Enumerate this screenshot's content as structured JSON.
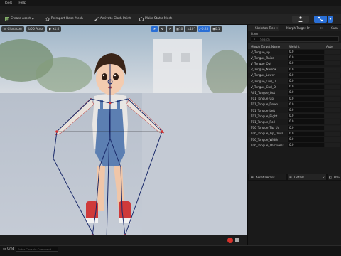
{
  "menubar": {
    "items": [
      "Tools",
      "Help"
    ]
  },
  "toolbar": {
    "buttons": [
      {
        "label": "Create Asset",
        "icon": "create-asset-icon",
        "has_dropdown": true
      },
      {
        "label": "Reimport Base Mesh",
        "icon": "reimport-icon"
      },
      {
        "label": "Activate Cloth Paint",
        "icon": "brush-icon"
      },
      {
        "label": "Make Static Mesh",
        "icon": "static-mesh-icon"
      }
    ]
  },
  "viewport": {
    "chips": [
      {
        "label": "Character",
        "icon": "menu-icon"
      },
      {
        "label": "LOD Auto"
      },
      {
        "label": "x1.0",
        "icon": "play-icon"
      }
    ],
    "tool_values": [
      "10",
      "10°",
      "0.25",
      "4",
      "0.1"
    ],
    "accent": "#2a6fd6"
  },
  "panel": {
    "tabs": [
      {
        "label": "Skeleton Tree",
        "active": true
      },
      {
        "label": "Morph Target Pr",
        "active": false
      },
      {
        "label": "Cura",
        "active": false
      }
    ],
    "items_label": "Item",
    "search_placeholder": "Search",
    "columns": {
      "name": "Morph Target Name",
      "weight": "Weight",
      "auto": "Auto"
    },
    "rows": [
      {
        "name": "V_Tongue_up",
        "weight": "0.0"
      },
      {
        "name": "V_Tongue_Raise",
        "weight": "0.0"
      },
      {
        "name": "V_Tongue_Out",
        "weight": "0.0"
      },
      {
        "name": "V_Tongue_Narrow",
        "weight": "0.0"
      },
      {
        "name": "V_Tongue_Lower",
        "weight": "0.0"
      },
      {
        "name": "V_Tongue_Curl_U",
        "weight": "0.0"
      },
      {
        "name": "V_Tongue_Curl_D",
        "weight": "0.0"
      },
      {
        "name": "A01_Tongue_Out",
        "weight": "0.0"
      },
      {
        "name": "T01_Tongue_Up",
        "weight": "0.0"
      },
      {
        "name": "T01_Tongue_Down",
        "weight": "0.0"
      },
      {
        "name": "T01_Tongue_Left",
        "weight": "0.0"
      },
      {
        "name": "T01_Tongue_Right",
        "weight": "0.0"
      },
      {
        "name": "T01_Tongue_Roll",
        "weight": "0.0"
      },
      {
        "name": "T06_Tongue_Tip_Up",
        "weight": "0.0"
      },
      {
        "name": "T06_Tongue_Tip_Down",
        "weight": "0.0"
      },
      {
        "name": "T06_Tongue_Width",
        "weight": "0.0"
      },
      {
        "name": "T06_Tongue_Thickness",
        "weight": "0.0"
      }
    ],
    "lower_tabs": [
      {
        "label": "Asset Details",
        "icon": "details-icon"
      },
      {
        "label": "Details",
        "icon": "details-icon"
      },
      {
        "label": "Prev",
        "icon": "preview-icon"
      }
    ]
  },
  "bottom": {
    "cmd_label": "Cmd",
    "cmd_placeholder": "Enter Console Command"
  },
  "colors": {
    "accent": "#2a6fd6",
    "record": "#d9322b"
  }
}
